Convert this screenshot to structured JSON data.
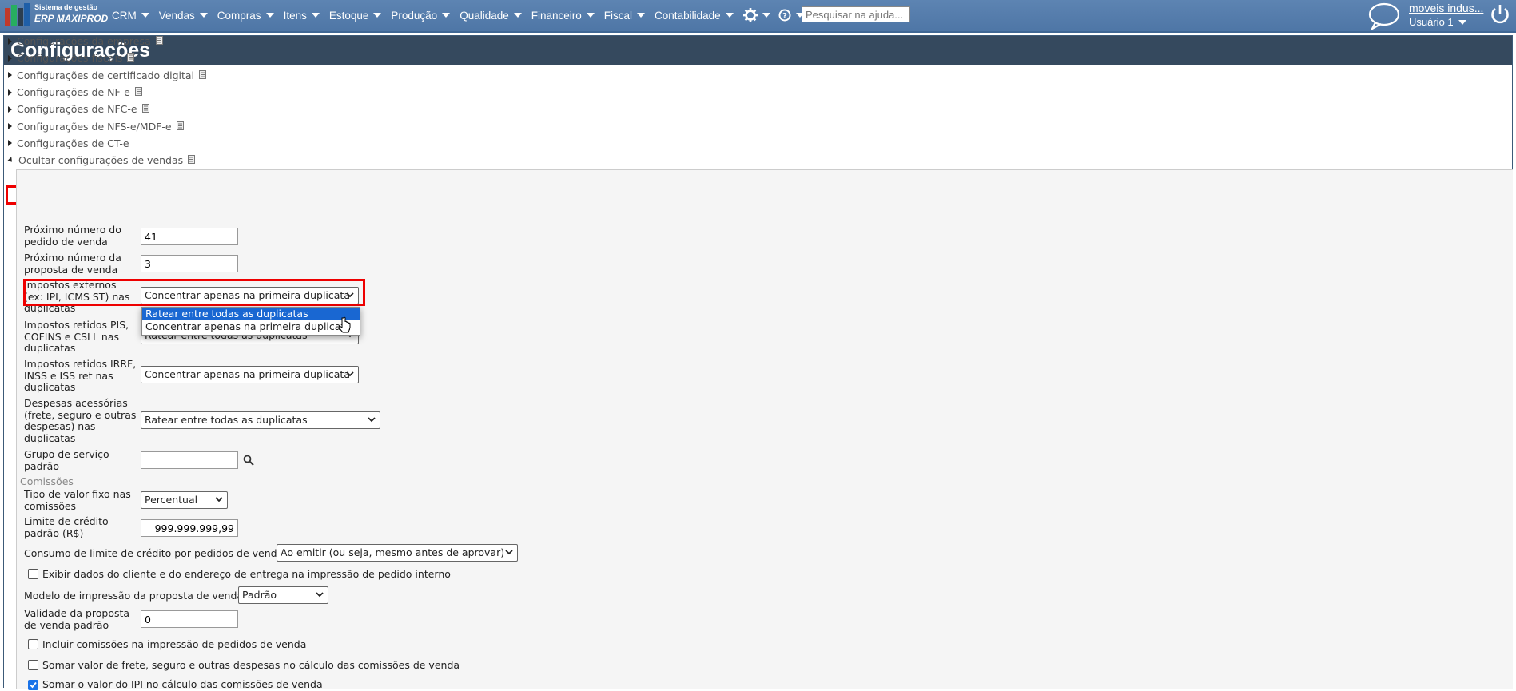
{
  "header": {
    "brand_small": "Sistema de gestão",
    "brand_big": "ERP MAXIPROD",
    "menu": [
      "CRM",
      "Vendas",
      "Compras",
      "Itens",
      "Estoque",
      "Produção",
      "Qualidade",
      "Financeiro",
      "Fiscal",
      "Contabilidade"
    ],
    "search_placeholder": "Pesquisar na ajuda...",
    "company_link": "moveis indus...",
    "user_name": "Usuário 1"
  },
  "page": {
    "title": "Configurações",
    "sections": [
      "Configurações da empresa",
      "Configurações fiscais",
      "Configurações de certificado digital",
      "Configurações de NF-e",
      "Configurações de NFC-e",
      "Configurações de NFS-e/MDF-e",
      "Configurações de CT-e"
    ],
    "open_section": "Ocultar configurações de vendas"
  },
  "form": {
    "next_order_label": [
      "Próximo número do",
      "pedido de venda"
    ],
    "next_order_value": "41",
    "next_proposal_label": [
      "Próximo número da",
      "proposta de venda"
    ],
    "next_proposal_value": "3",
    "ext_taxes_label": [
      "Impostos externos",
      "(ex: IPI, ICMS ST) nas",
      "duplicatas"
    ],
    "ext_taxes_value": "Concentrar apenas na primeira duplicata",
    "dropdown_options": [
      "Ratear entre todas as duplicatas",
      "Concentrar apenas na primeira duplicata"
    ],
    "pis_label": [
      "Impostos retidos PIS,",
      "COFINS e CSLL nas",
      "duplicatas"
    ],
    "pis_value": "Ratear entre todas as duplicatas",
    "irrf_label": [
      "Impostos retidos IRRF,",
      "INSS e ISS ret nas",
      "duplicatas"
    ],
    "irrf_value": "Concentrar apenas na primeira duplicata",
    "expenses_label": [
      "Despesas acessórias",
      "(frete, seguro e outras",
      "despesas) nas",
      "duplicatas"
    ],
    "expenses_value": "Ratear entre todas as duplicatas",
    "service_group_label": [
      "Grupo de serviço",
      "padrão"
    ],
    "service_group_value": "",
    "commissions_heading": "Comissões",
    "fixed_type_label": [
      "Tipo de valor fixo nas",
      "comissões"
    ],
    "fixed_type_value": "Percentual",
    "credit_limit_label": [
      "Limite de crédito",
      "padrão (R$)"
    ],
    "credit_limit_value": "999.999.999,99",
    "credit_consumption_label": "Consumo de limite de crédito por pedidos de venda",
    "credit_consumption_value": "Ao emitir (ou seja, mesmo antes de aprovar)",
    "show_client_label": "Exibir dados do cliente e do endereço de entrega na impressão de pedido interno",
    "print_model_label": "Modelo de impressão da proposta de venda",
    "print_model_value": "Padrão",
    "validity_label": [
      "Validade da proposta",
      "de venda padrão"
    ],
    "validity_value": "0",
    "include_commissions_label": "Incluir comissões na impressão de pedidos de venda",
    "sum_freight_label": "Somar valor de frete, seguro e outras despesas no cálculo das comissões de venda",
    "sum_ipi_label": "Somar o valor do IPI no cálculo das comissões de venda"
  }
}
